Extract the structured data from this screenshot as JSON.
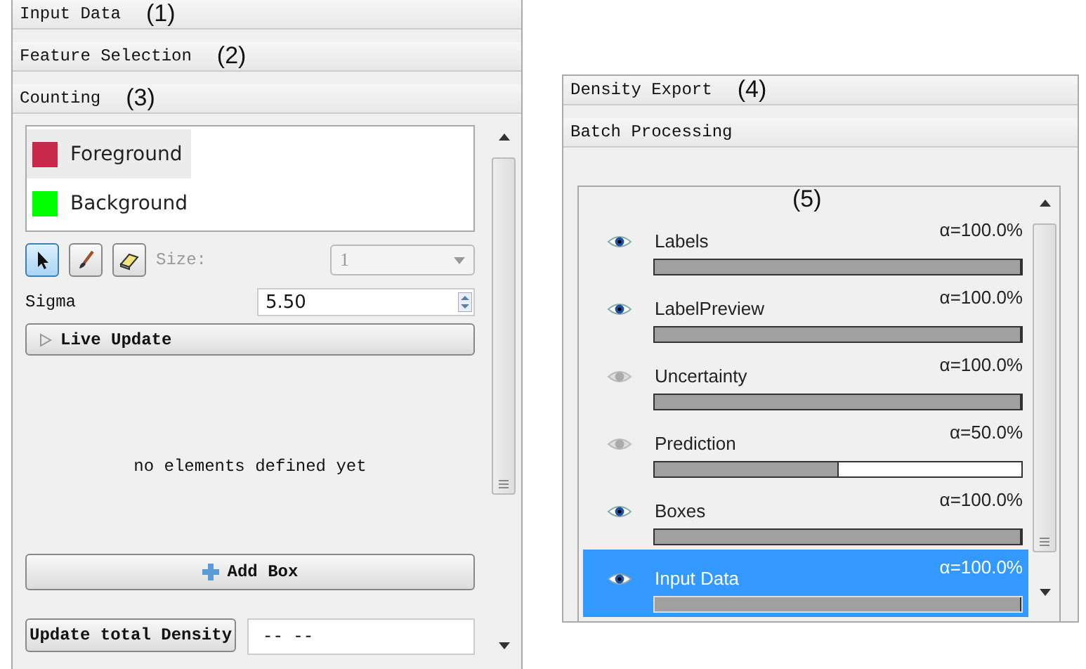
{
  "left_panel": {
    "sections": [
      {
        "title": "Input Data",
        "annotation": "(1)"
      },
      {
        "title": "Feature Selection",
        "annotation": "(2)"
      },
      {
        "title": "Counting",
        "annotation": "(3)"
      }
    ],
    "labels": [
      {
        "name": "Foreground",
        "color": "#c8294b",
        "selected": true
      },
      {
        "name": "Background",
        "color": "#00ff00",
        "selected": false
      }
    ],
    "tools": [
      {
        "kind": "pointer",
        "selected": true
      },
      {
        "kind": "brush",
        "selected": false
      },
      {
        "kind": "eraser",
        "selected": false
      }
    ],
    "size": {
      "label": "Size:",
      "value": "1",
      "disabled": true
    },
    "sigma": {
      "label": "Sigma",
      "value": "5.50"
    },
    "live_update": {
      "label": "Live Update",
      "expanded": false
    },
    "empty_message": "no elements defined yet",
    "add_box": "Add Box",
    "update_density": {
      "button": "Update total Density",
      "value": "-- --"
    }
  },
  "right_panel": {
    "sections": [
      {
        "title": "Density Export",
        "annotation": "(4)"
      },
      {
        "title": "Batch Processing"
      }
    ],
    "layers_annotation": "(5)",
    "layers": [
      {
        "name": "Labels",
        "alpha": "α=100.0%",
        "level": 1,
        "visible": true,
        "selected": false
      },
      {
        "name": "LabelPreview",
        "alpha": "α=100.0%",
        "level": 1,
        "visible": true,
        "selected": false
      },
      {
        "name": "Uncertainty",
        "alpha": "α=100.0%",
        "level": 1,
        "visible": false,
        "selected": false
      },
      {
        "name": "Prediction",
        "alpha": "α=50.0%",
        "level": 0.5,
        "visible": false,
        "selected": false
      },
      {
        "name": "Boxes",
        "alpha": "α=100.0%",
        "level": 1,
        "visible": true,
        "selected": false
      },
      {
        "name": "Input Data",
        "alpha": "α=100.0%",
        "level": 1,
        "visible": true,
        "selected": true
      }
    ]
  }
}
